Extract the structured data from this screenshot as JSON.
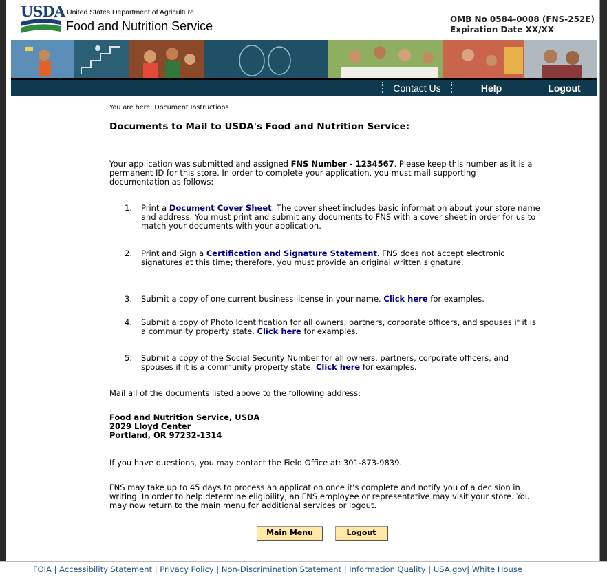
{
  "header": {
    "logo_text": "USDA",
    "agency_small": "United States Department of Agriculture",
    "agency_large": "Food and Nutrition Service",
    "omb_line1": "OMB No 0584-0008 (FNS-252E)",
    "omb_line2": "Expiration Date XX/XX"
  },
  "nav": {
    "contact": "Contact Us",
    "help": "Help",
    "logout": "Logout"
  },
  "breadcrumb": "You are here: Document Instructions",
  "title": "Documents to Mail to USDA's Food and Nutrition Service:",
  "intro": {
    "part1": "Your application was submitted and assigned ",
    "fns_number": "FNS Number - 1234567",
    "part2": ". Please keep this number as it is a permanent ID for this store. In order to complete your application, you must mail supporting documentation as follows:"
  },
  "steps": [
    {
      "num": "1.",
      "pre": "Print a ",
      "link": "Document Cover Sheet",
      "post": ". The cover sheet includes basic information about your store name and address. You must print and submit any documents to FNS with a cover sheet in order for us to match your documents with your application."
    },
    {
      "num": "2.",
      "pre": "Print and Sign a ",
      "link": "Certification and Signature Statement",
      "post": ". FNS does not accept electronic signatures at this time; therefore, you must provide an original written signature."
    },
    {
      "num": "3.",
      "pre": "Submit a copy of one current business license in your name. ",
      "link": "Click here",
      "post": " for examples."
    },
    {
      "num": "4.",
      "pre": "Submit a copy of Photo Identification for all owners, partners, corporate officers, and spouses if it is a community property state. ",
      "link": "Click here",
      "post": " for examples."
    },
    {
      "num": "5.",
      "pre": "Submit a copy of the Social Security Number for all owners, partners, corporate officers, and spouses if it is a community property state. ",
      "link": "Click here",
      "post": " for examples."
    }
  ],
  "mail_instruction": "Mail all of the documents listed above to the following address:",
  "address": {
    "line1": "Food and Nutrition Service, USDA",
    "line2": "2029 Lloyd Center",
    "line3": "Portland, OR 97232-1314"
  },
  "questions": "If you have questions, you may contact the Field Office at: 301-873-9839.",
  "processing": "FNS may take up to 45 days to process an application once it's complete and notify you of a decision in writing. In order to help determine eligibility, an FNS employee or representative may visit your store. You may now return to the main menu for additional services or logout.",
  "buttons": {
    "main_menu": "Main Menu",
    "logout": "Logout"
  },
  "footer": {
    "links": [
      "FOIA",
      "Accessibility Statement",
      "Privacy Policy",
      "Non-Discrimination Statement",
      "Information Quality",
      "USA.gov",
      "White House"
    ]
  },
  "colors": {
    "nav_bg": "#0f3a4d",
    "link": "#00008b",
    "button_bg": "#ffe9a5",
    "logo_blue": "#1b3f73",
    "logo_green": "#2e8b3a"
  }
}
